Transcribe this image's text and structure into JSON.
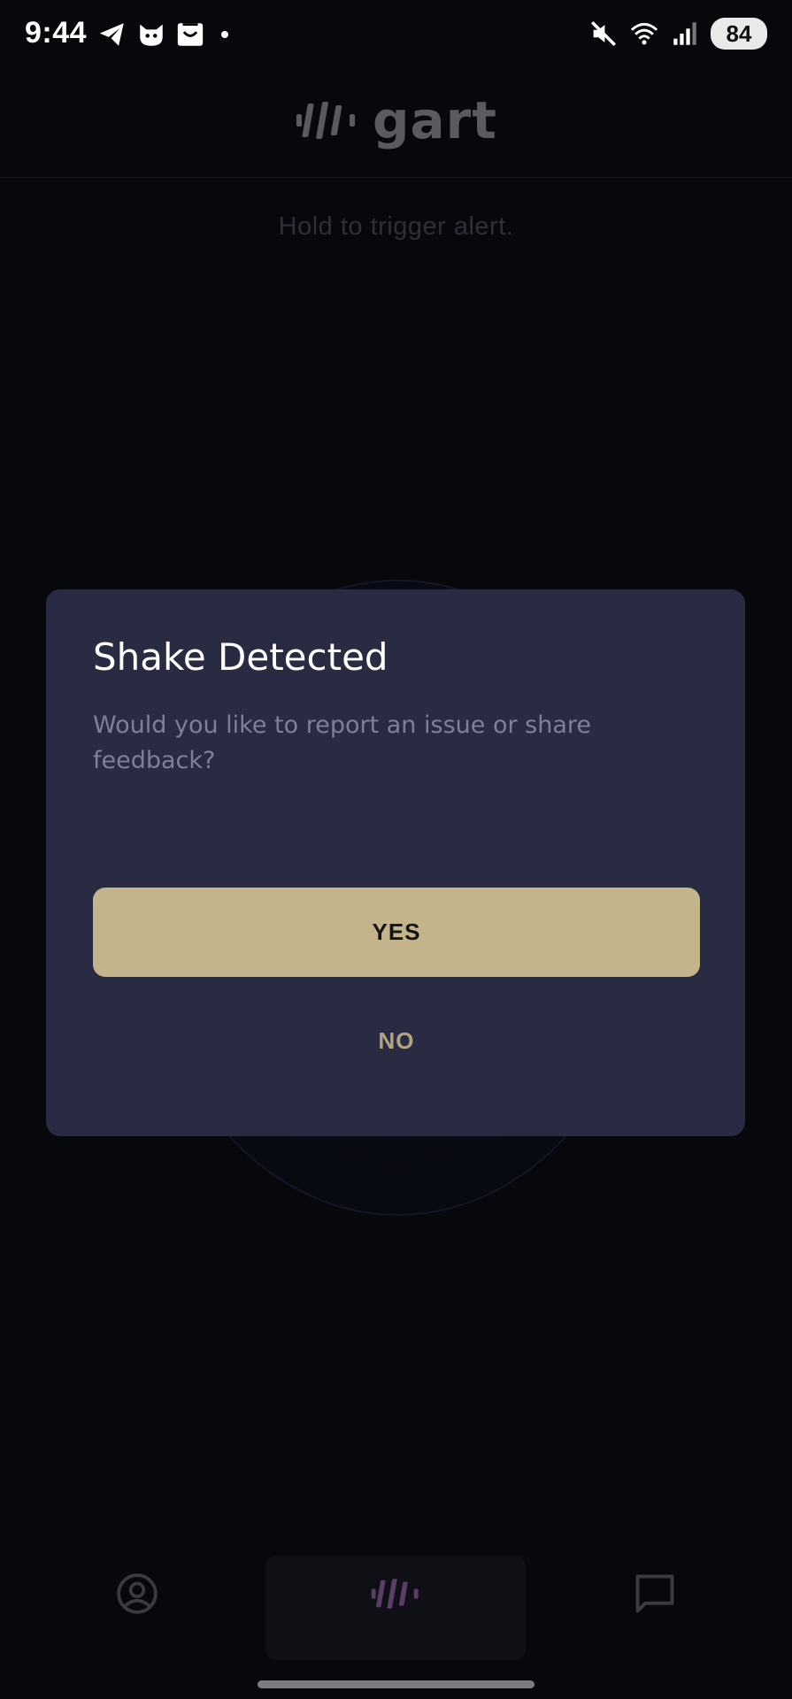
{
  "status_bar": {
    "time": "9:44",
    "left_icons": [
      "telegram-icon",
      "cat-app-icon",
      "shopping-bag-icon",
      "notification-dot"
    ],
    "right_icons": [
      "mute-icon",
      "wifi-icon",
      "signal-icon"
    ],
    "battery": "84"
  },
  "header": {
    "logo_text": "gart"
  },
  "main": {
    "hint": "Hold to trigger alert."
  },
  "dialog": {
    "title": "Shake Detected",
    "message": "Would you like to report an issue or share feedback?",
    "yes_label": "YES",
    "no_label": "NO"
  },
  "bottom_nav": {
    "items": [
      {
        "icon": "profile-icon"
      },
      {
        "icon": "alert-waveform-icon"
      },
      {
        "icon": "chat-icon"
      }
    ]
  },
  "colors": {
    "background": "#07080c",
    "dialog": "#292b42",
    "accent": "#c4b48c",
    "accent_text": "#b3a47f",
    "muted_text": "#7f8096"
  }
}
